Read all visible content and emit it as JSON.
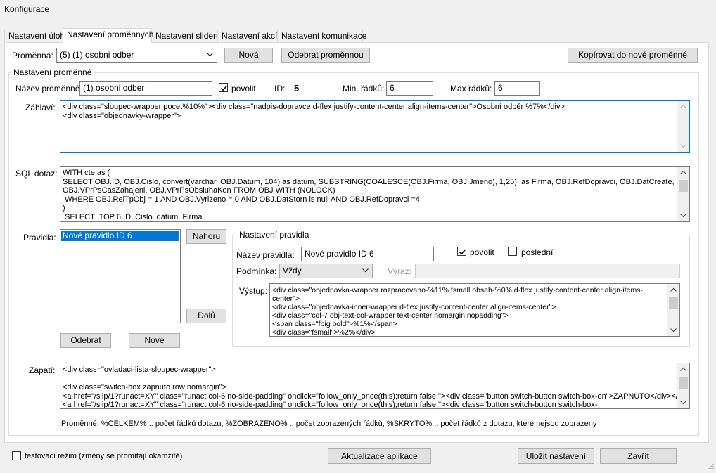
{
  "window": {
    "title": "Konfigurace"
  },
  "tabs": [
    {
      "label": "Nastavení úloh"
    },
    {
      "label": "Nastavení proměnných"
    },
    {
      "label": "Nastavení sliderů"
    },
    {
      "label": "Nastavení akcí"
    },
    {
      "label": "Nastavení komunikace"
    }
  ],
  "variable_row": {
    "label": "Proměnná:",
    "selected": "(5) (1) osobni odber",
    "new_label": "Nová",
    "remove_label": "Odebrat proměnnou",
    "copy_label": "Kopírovat do nové proměnné"
  },
  "settings": {
    "group_title": "Nastavení proměnné",
    "name_label": "Název proměnné:",
    "name_value": "(1) osobni odber",
    "allow_label": "povolit",
    "allow_checked": true,
    "id_label": "ID:",
    "id_value": "5",
    "min_label": "Min. řádků:",
    "min_value": "6",
    "max_label": "Max řádků:",
    "max_value": "6"
  },
  "header": {
    "label": "Záhlaví:",
    "lines": [
      "<div class=\"sloupec-wrapper pocet%10%\"><div class=\"nadpis-dopravce d-flex justify-content-center align-items-center\">Osobní odběr %7%</div>",
      "<div class=\"objednavky-wrapper\">"
    ]
  },
  "sql": {
    "label": "SQL dotaz:",
    "lines": [
      "WITH cte as (",
      "SELECT OBJ.ID, OBJ.Cislo, convert(varchar, OBJ.Datum, 104) as datum, SUBSTRING(COALESCE(OBJ.Firma, OBJ.Jmeno), 1,25)  as Firma, OBJ.RefDopravci, OBJ.DatCreate,",
      "OBJ.VPrPsCasZahajeni, OBJ.VPrPsObsluhaKon FROM OBJ WITH (NOLOCK)",
      " WHERE OBJ.RelTpObj = 1 AND OBJ.Vyrizeno = 0 AND OBJ.DatStorn is null AND OBJ.RefDopravci =4",
      ")",
      " SELECT  TOP 6 ID. Cislo. datum. Firma."
    ]
  },
  "rules": {
    "label": "Pravidla:",
    "items": [
      "Nové pravidlo ID 6"
    ],
    "up_label": "Nahoru",
    "down_label": "Dolů",
    "remove_label": "Odebrat",
    "new_label": "Nové"
  },
  "rule_settings": {
    "group_title": "Nastavení pravidla",
    "name_label": "Název pravidla:",
    "name_value": "Nové pravidlo ID 6",
    "allow_label": "povolit",
    "allow_checked": true,
    "last_label": "poslední",
    "last_checked": false,
    "condition_label": "Podmínka:",
    "condition_value": "Vždy",
    "expression_label": "Výraz:",
    "expression_value": "",
    "output_label": "Výstup:",
    "output_lines": [
      "<div class=\"objednavka-wrapper rozpracovano-%11% fsmall obsah-%0% d-flex justify-content-center align-items-",
      "center\">",
      "<div class=\"objednavka-inner-wrapper d-flex justify-content-center align-items-center\">",
      "<div class=\"col-7 obj-text-col-wrapper text-center nomargin nopadding\">",
      "<span class=\"fbig bold\">%1%</span>",
      "<div class=\"fsmall\">%2%</div>"
    ]
  },
  "footer": {
    "label": "Zápatí:",
    "lines": [
      "<div class=\"ovladaci-lista-sloupec-wrapper\">",
      "",
      "<div class=\"switch-box zapnuto row nomargin\">",
      "<a href=\"/slip/1?runact=XY\" class=\"runact col-6 no-side-padding\" onclick=\"follow_only_once(this);return false;\"><div class=\"button switch-button switch-box-on\">ZAPNUTO</div></a>",
      "<a href=\"/slip/1?runact=XY\" class=\"runact col-6 no-side-padding\" onclick=\"follow_only_once(this);return false;\"><div class=\"button switch-button switch-box-"
    ]
  },
  "hint": "Proměnné: %CELKEM% .. počet řádků dotazu, %ZOBRAZENO% .. počet zobrazených řádků, %SKRYTO% .. počet řádků z dotazu, které nejsou zobrazeny",
  "bottom": {
    "test_mode_label": "testovací režim (změny se promítají okamžitě)",
    "test_mode_checked": false,
    "update_label": "Aktualizace aplikace",
    "save_label": "Uložit nastavení",
    "close_label": "Zavřít"
  },
  "icons": {
    "dropdown": "chevron-down-icon",
    "check": "checkmark-icon",
    "scroll_up": "scroll-up-arrow-icon",
    "scroll_down": "scroll-down-arrow-icon",
    "resize_grip": "resize-grip-icon"
  },
  "colors": {
    "selection": "#0078d7",
    "focus_border": "#0078d7",
    "button_face": "#e1e1e1",
    "window_bg": "#f0f0f0"
  }
}
